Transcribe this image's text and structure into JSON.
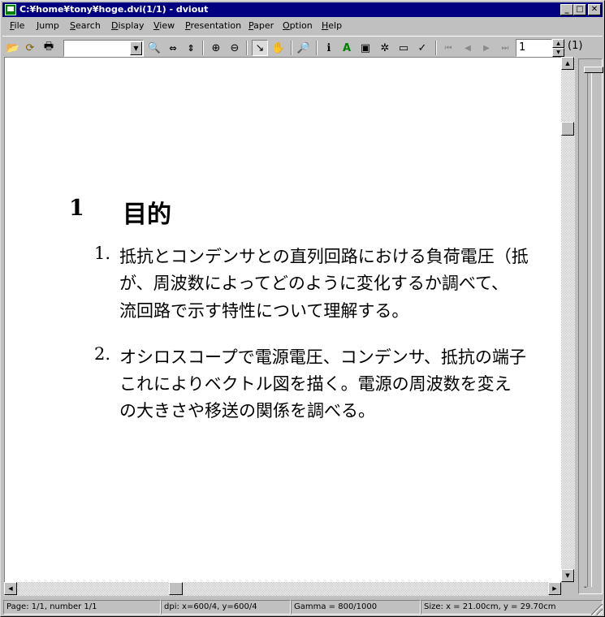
{
  "window": {
    "title": "C:¥home¥tony¥hoge.dvi(1/1) - dviout",
    "minimize": "_",
    "maximize": "□",
    "close": "✕"
  },
  "menu": [
    "File",
    "Jump",
    "Search",
    "Display",
    "View",
    "Presentation",
    "Paper",
    "Option",
    "Help"
  ],
  "toolbar": {
    "combo_value": "",
    "page_input": "1",
    "page_total": "(1)",
    "icons": {
      "open": "📂",
      "reload": "⟳",
      "print": "🖶",
      "preview": "🔍",
      "zoom_in": "⊕",
      "zoom_out": "⊖",
      "select": "↘",
      "hand": "✋",
      "find": "🔎",
      "info": "ℹ",
      "check": "✓",
      "first": "⏮",
      "prev": "◀",
      "next": "▶",
      "last": "⏭"
    }
  },
  "document": {
    "section_number": "1",
    "section_title": "目的",
    "items": [
      {
        "num": "1.",
        "lines": [
          "抵抗とコンデンサとの直列回路における負荷電圧（抵",
          "が、周波数によってどのように変化するか調べて、",
          "流回路で示す特性について理解する。"
        ]
      },
      {
        "num": "2.",
        "lines": [
          "オシロスコープで電源電圧、コンデンサ、抵抗の端子",
          "これによりベクトル図を描く。電源の周波数を変え",
          "の大きさや移送の関係を調べる。"
        ]
      }
    ]
  },
  "side_panel": {
    "tick_label": "-"
  },
  "status": {
    "page": "Page: 1/1, number 1/1",
    "dpi": "dpi: x=600/4, y=600/4",
    "gamma": "Gamma = 800/1000",
    "size": "Size: x = 21.00cm, y = 29.70cm"
  }
}
